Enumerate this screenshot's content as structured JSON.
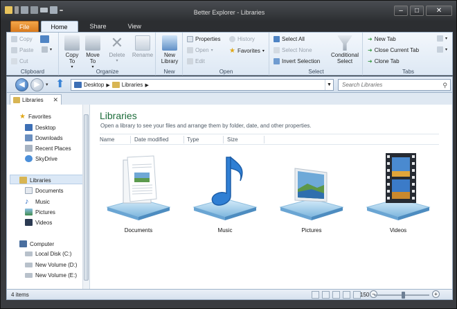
{
  "window": {
    "title": "Better Explorer - Libraries"
  },
  "ribbon_tabs": [
    "File",
    "Home",
    "Share",
    "View"
  ],
  "ribbon": {
    "clipboard": {
      "label": "Clipboard",
      "copy": "Copy",
      "paste": "Paste",
      "cut": "Cut"
    },
    "organize": {
      "label": "Organize",
      "copy_to": "Copy\nTo",
      "move_to": "Move\nTo",
      "delete": "Delete",
      "rename": "Rename"
    },
    "new": {
      "label": "New",
      "new_library": "New\nLibrary"
    },
    "open": {
      "label": "Open",
      "properties": "Properties",
      "open": "Open",
      "edit": "Edit",
      "history": "History",
      "favorites": "Favorites"
    },
    "select": {
      "label": "Select",
      "select_all": "Select All",
      "select_none": "Select None",
      "invert_selection": "Invert Selection",
      "conditional_select": "Conditional\nSelect"
    },
    "tabs": {
      "label": "Tabs",
      "new_tab": "New Tab",
      "close_current_tab": "Close Current Tab",
      "clone_tab": "Clone Tab"
    }
  },
  "address": {
    "crumbs": [
      "Desktop",
      "Libraries"
    ]
  },
  "search": {
    "placeholder": "Search Libraries"
  },
  "folder_tab": {
    "label": "Libraries"
  },
  "nav": {
    "favorites": {
      "label": "Favorites",
      "items": [
        "Desktop",
        "Downloads",
        "Recent Places",
        "SkyDrive"
      ]
    },
    "libraries": {
      "label": "Libraries",
      "items": [
        "Documents",
        "Music",
        "Pictures",
        "Videos"
      ]
    },
    "computer": {
      "label": "Computer",
      "items": [
        "Local Disk (C:)",
        "New Volume (D:)",
        "New Volume (E:)"
      ]
    }
  },
  "content": {
    "title": "Libraries",
    "subtitle": "Open a library to see your files and arrange them by folder, date, and other properties.",
    "columns": [
      "Name",
      "Date modified",
      "Type",
      "Size"
    ],
    "libraries": [
      "Documents",
      "Music",
      "Pictures",
      "Videos"
    ]
  },
  "status": {
    "count": "4 items",
    "zoom": "150"
  }
}
